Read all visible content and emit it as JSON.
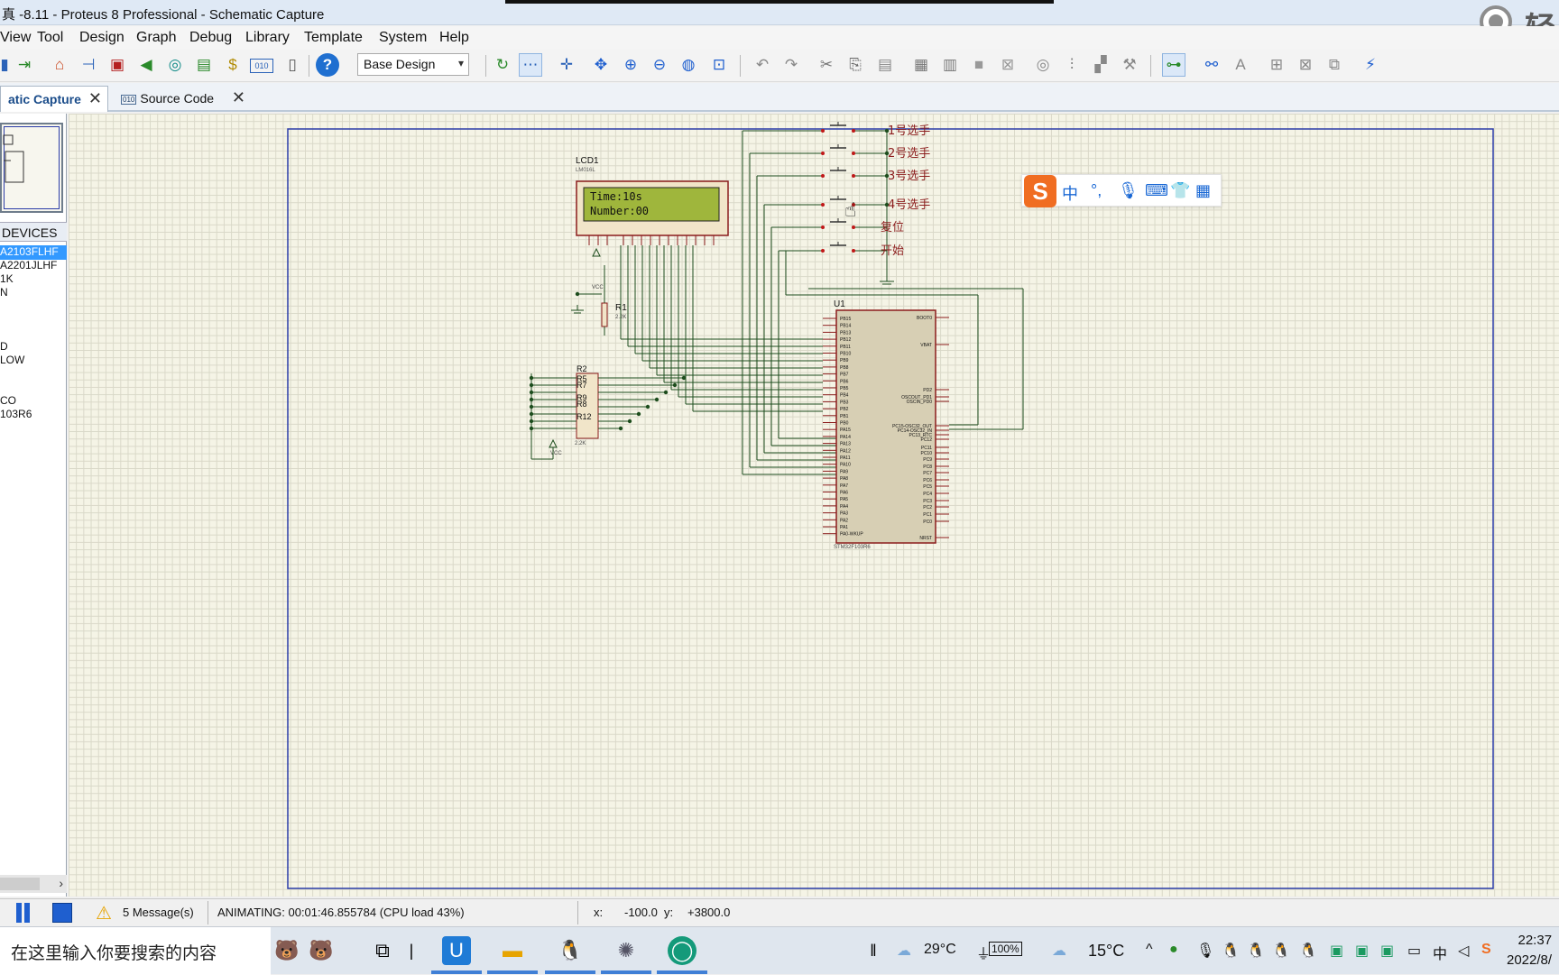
{
  "window": {
    "title": "真 -8.11 - Proteus 8 Professional - Schematic Capture",
    "brand_text": "轻E"
  },
  "menu": [
    "View",
    "Tool",
    "Design",
    "Graph",
    "Debug",
    "Library",
    "Template",
    "System",
    "Help"
  ],
  "toolbar": {
    "design_select": "Base Design",
    "icons": [
      "export-icon",
      "import-icon",
      "home-icon",
      "schematic-icon",
      "pcb-icon",
      "gallery-icon",
      "simulate-icon",
      "bom-icon",
      "pcb-3d-icon",
      "bom-report-icon",
      "source-code-icon",
      "notes-icon",
      "help-icon",
      "refresh-icon",
      "grid-icon",
      "origin-icon",
      "pan-icon",
      "zoom-in-icon",
      "zoom-out-icon",
      "zoom-all-icon",
      "zoom-area-icon",
      "undo-icon",
      "redo-icon",
      "cut-icon",
      "copy-icon",
      "paste-icon",
      "block-copy-icon",
      "block-move-icon",
      "block-rotate-icon",
      "block-delete-icon",
      "pick-device-icon",
      "make-device-icon",
      "package-tool-icon",
      "decompose-icon",
      "wire-autorouter-icon",
      "search-icon",
      "property-tool-icon",
      "new-sheet-icon",
      "remove-sheet-icon",
      "goto-sheet-icon",
      "netlist-icon"
    ]
  },
  "tabs": [
    {
      "label": "atic Capture",
      "active": true
    },
    {
      "label": "Source Code",
      "active": false
    }
  ],
  "left_panel": {
    "header": "DEVICES",
    "devices": [
      "A2103FLHF",
      "A2201JLHF",
      "1K",
      "N",
      "",
      "",
      "",
      "D",
      "LOW",
      "",
      "",
      "CO",
      "103R6"
    ],
    "selected_index": 0
  },
  "schematic": {
    "lcd": {
      "ref": "LCD1",
      "part": "LM016L",
      "line1": "Time:10s",
      "line2": "Number:00"
    },
    "buttons": [
      {
        "label": "1号选手"
      },
      {
        "label": "2号选手"
      },
      {
        "label": "3号选手"
      },
      {
        "label": "4号选手"
      },
      {
        "label": "复位"
      },
      {
        "label": "开始"
      }
    ],
    "mcu": {
      "ref": "U1",
      "part": "STM32F103R6",
      "left_pins": [
        "PB15",
        "PB14",
        "PB13",
        "PB12",
        "PB11",
        "PB10",
        "PB9",
        "PB8",
        "PB7",
        "PB6",
        "PB5",
        "PB4",
        "PB3",
        "PB2",
        "PB1",
        "PB0",
        "PA15",
        "PA14",
        "PA13",
        "PA12",
        "PA11",
        "PA10",
        "PA9",
        "PA8",
        "PA7",
        "PA6",
        "PA5",
        "PA4",
        "PA3",
        "PA2",
        "PA1",
        "PA0-WKUP"
      ],
      "right_pins": [
        "BOOT0",
        "VBAT",
        "PD2",
        "OSCOUT_PD1",
        "OSCIN_PD0",
        "PC15-OSC32_OUT",
        "PC14-OSC32_IN",
        "PC13_RTC",
        "PC12",
        "PC11",
        "PC10",
        "PC9",
        "PC8",
        "PC7",
        "PC6",
        "PC5",
        "PC4",
        "PC3",
        "PC2",
        "PC1",
        "PC0",
        "NRST"
      ]
    },
    "r1": {
      "ref": "R1",
      "value": "2.2K"
    },
    "resistor_pack": {
      "refs": [
        "R2",
        "R5",
        "R7",
        "R9",
        "R8",
        "R12"
      ],
      "value": "2.2K"
    },
    "vcc_label": "VCC"
  },
  "ime": {
    "logo": "S",
    "mode": "中",
    "punct": "°,"
  },
  "status": {
    "messages": "5 Message(s)",
    "animating": "ANIMATING: 00:01:46.855784 (CPU load 43%)",
    "x_label": "x:",
    "x_value": "-100.0",
    "y_label": "y:",
    "y_value": "+3800.0"
  },
  "taskbar": {
    "search_placeholder": "在这里输入你要搜索的内容",
    "weather1": "29°C",
    "battery": "100%",
    "weather2": "15°C",
    "ime_lang": "中",
    "time": "22:37",
    "date": "2022/8/"
  },
  "colors": {
    "canvas_bg": "#f5f4e6",
    "wire": "#1d4d1d",
    "component": "#8b1c1c",
    "sheet_border": "#2b3ca8",
    "selection": "#3399ff"
  }
}
